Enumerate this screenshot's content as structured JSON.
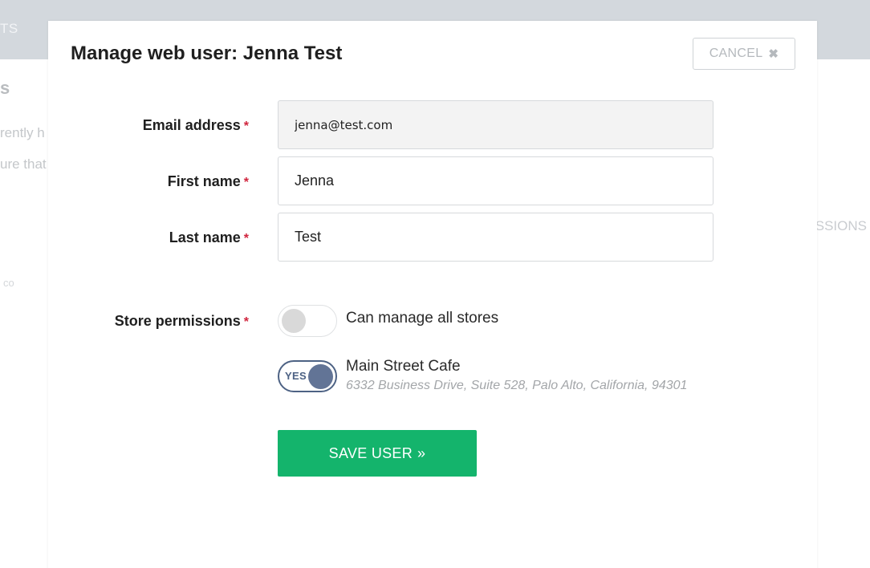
{
  "background": {
    "header_text": "TS",
    "heading": "s",
    "line1": "rently h",
    "line2": "ure that",
    "right_text": "SSIONS",
    "small_text": "co"
  },
  "modal": {
    "title": "Manage web user: Jenna Test",
    "cancel_label": "CANCEL",
    "cancel_icon": "close-icon",
    "fields": {
      "email": {
        "label": "Email address",
        "value": "jenna@test.com",
        "required": "*"
      },
      "first_name": {
        "label": "First name",
        "value": "Jenna",
        "required": "*"
      },
      "last_name": {
        "label": "Last name",
        "value": "Test",
        "required": "*"
      }
    },
    "permissions": {
      "label": "Store permissions",
      "required": "*",
      "all_stores": {
        "label": "Can manage all stores",
        "enabled": false
      },
      "store": {
        "name": "Main Street Cafe",
        "address": "6332 Business Drive, Suite 528, Palo Alto, California, 94301",
        "toggle_text": "YES",
        "enabled": true
      }
    },
    "save_label": "SAVE USER",
    "save_icon": "double-chevron-right-icon"
  },
  "colors": {
    "save_green": "#14b46c",
    "required_red": "#d0243d",
    "toggle_blue": "#627496",
    "header_gray": "#d3d8dd"
  }
}
